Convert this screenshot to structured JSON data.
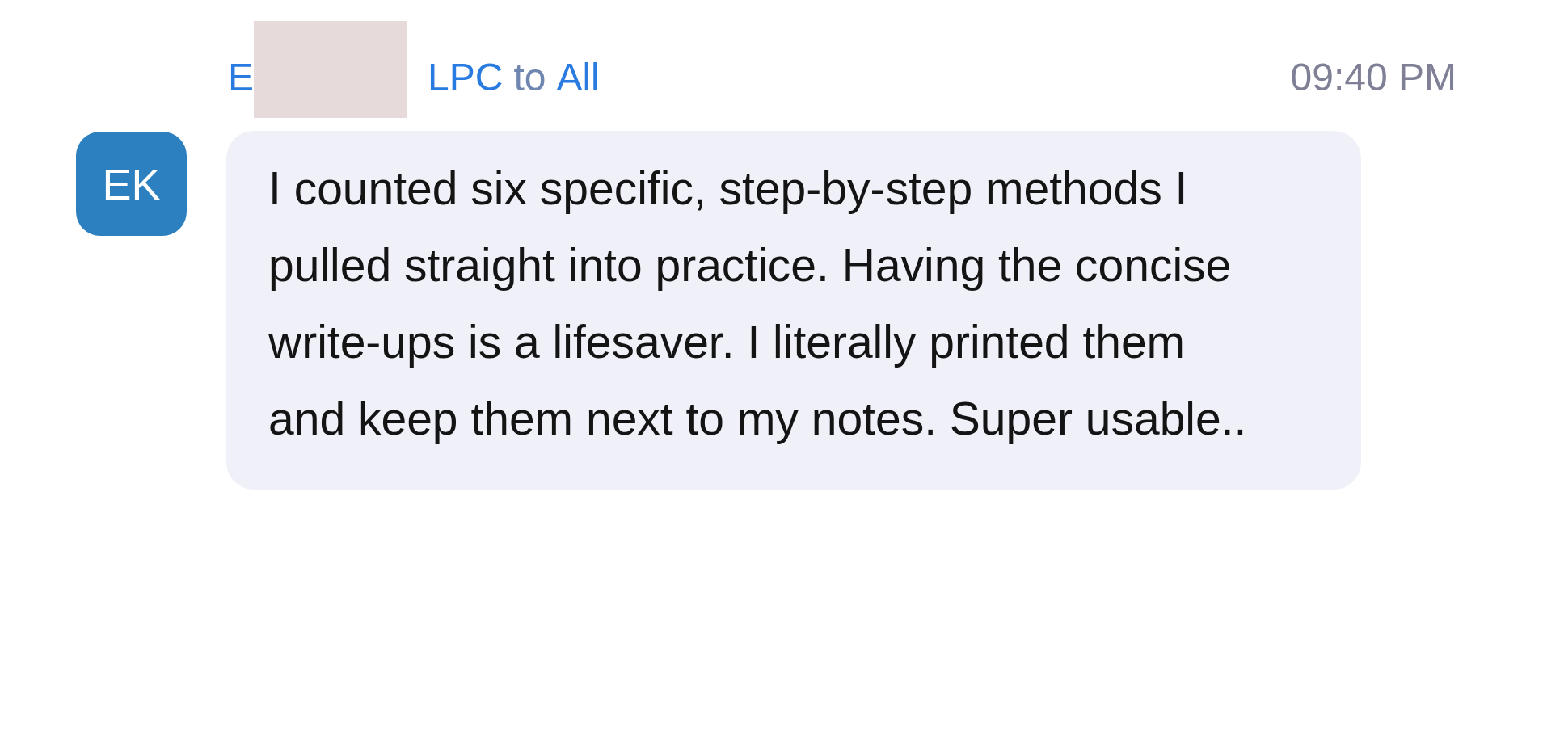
{
  "message": {
    "avatar": {
      "initials": "EK"
    },
    "sender": {
      "name_start": "E",
      "redacted": true,
      "name_end": "LPC"
    },
    "connector": "to",
    "recipient": "All",
    "time": "09:40 PM",
    "text": "I counted six specific, step-by-step methods I pulled straight into practice. Having the concise write-ups is a lifesaver. I literally printed them and keep them next to my notes. Super usable.."
  }
}
